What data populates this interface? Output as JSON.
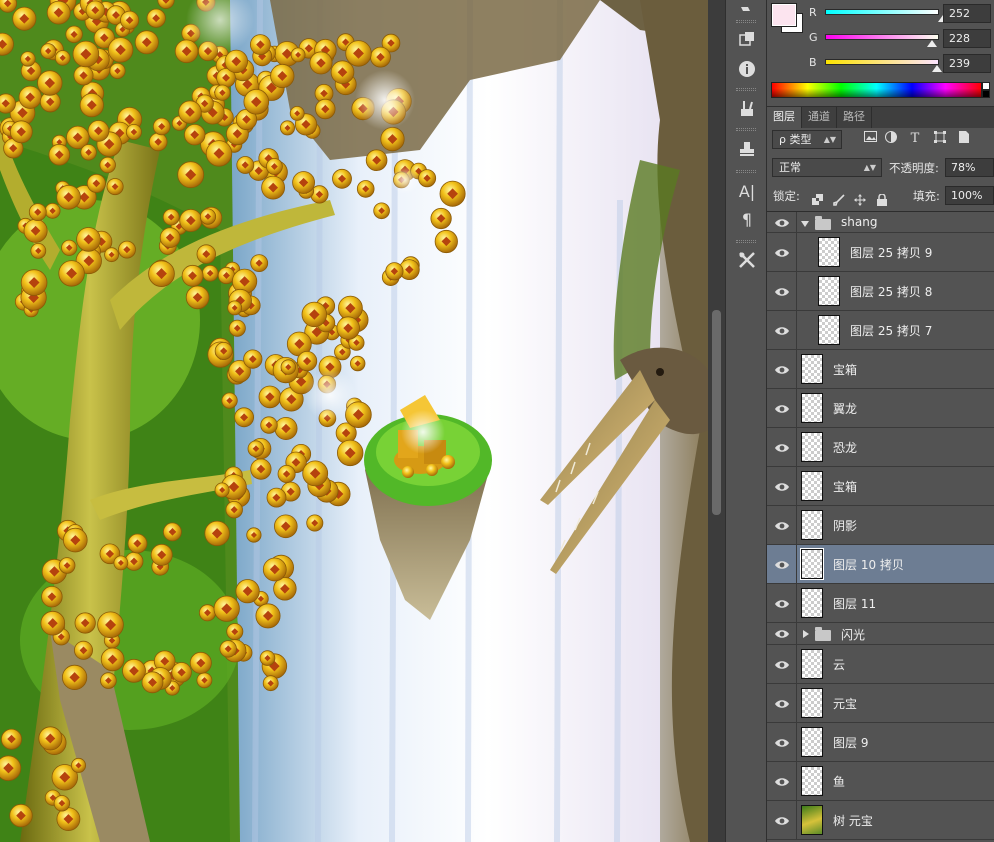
{
  "color_panel": {
    "channels": [
      {
        "label": "R",
        "value": "252",
        "gradient_from": "#00ffff",
        "gradient_to": "#ffffff",
        "level": 0.988
      },
      {
        "label": "G",
        "value": "228",
        "gradient_from": "#fc00ef",
        "gradient_to": "#fcffef",
        "level": 0.894
      },
      {
        "label": "B",
        "value": "239",
        "gradient_from": "#fce400",
        "gradient_to": "#fce4ff",
        "level": 0.937
      }
    ],
    "foreground_color": "#fce4ef",
    "background_color": "#ffffff"
  },
  "layers_panel": {
    "tabs": [
      {
        "label": "图层",
        "active": true
      },
      {
        "label": "通道",
        "active": false
      },
      {
        "label": "路径",
        "active": false
      }
    ],
    "filter": {
      "label": "ρ 类型"
    },
    "blend_mode": "正常",
    "opacity_label": "不透明度:",
    "opacity_value": "78%",
    "lock_label": "锁定:",
    "fill_label": "填充:",
    "fill_value": "100%",
    "layers": [
      {
        "name": "shang",
        "kind": "group",
        "expanded": true,
        "indent": 0,
        "selected": false
      },
      {
        "name": "图层 25 拷贝 9",
        "kind": "layer",
        "indent": 1,
        "selected": false
      },
      {
        "name": "图层 25 拷贝 8",
        "kind": "layer",
        "indent": 1,
        "selected": false
      },
      {
        "name": "图层 25 拷贝 7",
        "kind": "layer",
        "indent": 1,
        "selected": false
      },
      {
        "name": "宝箱",
        "kind": "layer",
        "indent": 0,
        "selected": false
      },
      {
        "name": "翼龙",
        "kind": "layer",
        "indent": 0,
        "selected": false
      },
      {
        "name": "恐龙",
        "kind": "layer",
        "indent": 0,
        "selected": false
      },
      {
        "name": "宝箱",
        "kind": "layer",
        "indent": 0,
        "selected": false
      },
      {
        "name": "阴影",
        "kind": "layer",
        "indent": 0,
        "selected": false
      },
      {
        "name": "图层 10 拷贝",
        "kind": "layer",
        "indent": 0,
        "selected": true
      },
      {
        "name": "图层 11",
        "kind": "layer",
        "indent": 0,
        "selected": false
      },
      {
        "name": "闪光",
        "kind": "group",
        "expanded": false,
        "indent": 0,
        "selected": false
      },
      {
        "name": "云",
        "kind": "layer",
        "indent": 0,
        "selected": false
      },
      {
        "name": "元宝",
        "kind": "layer",
        "indent": 0,
        "selected": false
      },
      {
        "name": "图层 9",
        "kind": "layer",
        "indent": 0,
        "selected": false
      },
      {
        "name": "鱼",
        "kind": "layer",
        "indent": 0,
        "selected": false
      },
      {
        "name": "树 元宝",
        "kind": "layer",
        "indent": 0,
        "selected": false,
        "thumb": "tree"
      }
    ]
  },
  "tools": [
    {
      "icon": "history-brush-icon"
    },
    {
      "icon": "3d-object-icon"
    },
    {
      "icon": "info-icon",
      "glyph": "i"
    },
    {
      "icon": "brushes-icon"
    },
    {
      "icon": "clone-source-icon"
    },
    {
      "icon": "character-icon",
      "glyph": "A|"
    },
    {
      "icon": "paragraph-icon",
      "glyph": "¶"
    },
    {
      "icon": "tool-presets-icon"
    }
  ]
}
